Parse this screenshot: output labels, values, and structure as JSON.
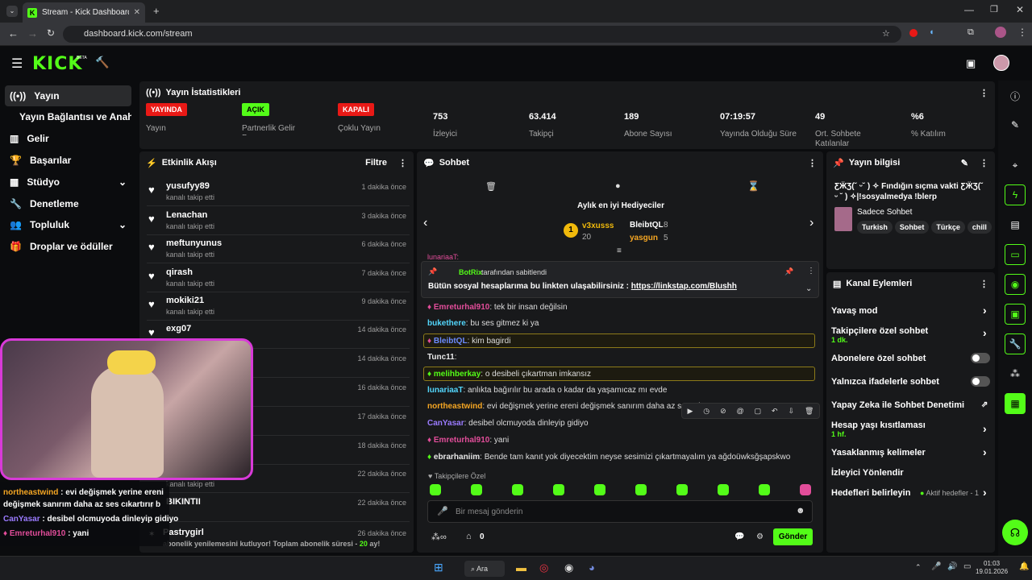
{
  "browser": {
    "tab_title": "Stream - Kick Dashboard",
    "url": "dashboard.kick.com/stream"
  },
  "nav": {
    "logo": "KICK",
    "beta": "BETA"
  },
  "sidebar": {
    "items": [
      {
        "label": "Yayın",
        "icon": "broadcast-icon"
      },
      {
        "label": "Yayın Bağlantısı ve Anahtarı"
      },
      {
        "label": "Gelir",
        "icon": "chart-icon"
      },
      {
        "label": "Başarılar",
        "icon": "trophy-icon"
      },
      {
        "label": "Stüdyo",
        "icon": "studio-icon"
      },
      {
        "label": "Denetleme",
        "icon": "wrench-icon"
      },
      {
        "label": "Topluluk",
        "icon": "community-icon"
      },
      {
        "label": "Droplar ve ödüller",
        "icon": "gift-icon"
      }
    ]
  },
  "stats": {
    "title": "Yayın İstatistikleri",
    "items": [
      {
        "badge": "YAYINDA",
        "label": "Yayın",
        "color": "#e91916"
      },
      {
        "badge": "AÇIK",
        "label": "Partnerlik Gelir Programı",
        "color": "#53fc18"
      },
      {
        "badge": "KAPALI",
        "label": "Çoklu Yayın",
        "color": "#e91916"
      },
      {
        "value": "753",
        "label": "İzleyici"
      },
      {
        "value": "63.414",
        "label": "Takipçi"
      },
      {
        "value": "189",
        "label": "Abone Sayısı"
      },
      {
        "value": "07:19:57",
        "label": "Yayında Olduğu Süre"
      },
      {
        "value": "49",
        "label": "Ort. Sohbete Katılanlar"
      },
      {
        "value": "%6",
        "label": "% Katılım"
      }
    ]
  },
  "activity": {
    "title": "Etkinlik Akışı",
    "filter": "Filtre",
    "items": [
      {
        "name": "yusufyy89",
        "sub": "kanalı takip etti",
        "time": "1 dakika önce"
      },
      {
        "name": "Lenachan",
        "sub": "kanalı takip etti",
        "time": "3 dakika önce"
      },
      {
        "name": "meftunyunus",
        "sub": "kanalı takip etti",
        "time": "6 dakika önce"
      },
      {
        "name": "qirash",
        "sub": "kanalı takip etti",
        "time": "7 dakika önce"
      },
      {
        "name": "mokiki21",
        "sub": "kanalı takip etti",
        "time": "9 dakika önce"
      },
      {
        "name": "exg07",
        "sub": "",
        "time": "14 dakika önce"
      },
      {
        "name": "",
        "sub": "",
        "time": "14 dakika önce"
      },
      {
        "name": "",
        "sub": "",
        "time": "16 dakika önce"
      },
      {
        "name": "",
        "sub": "",
        "time": "17 dakika önce"
      },
      {
        "name": "",
        "sub": "",
        "time": "18 dakika önce"
      },
      {
        "name": "",
        "sub": "kanalı takip etti",
        "time": "22 dakika önce"
      },
      {
        "name": "BIKINTII",
        "sub": "",
        "time": "22 dakika önce"
      }
    ],
    "last": {
      "name": "Pastrygirl",
      "text": "abonelik yenilemesini kutluyor! Toplam abonelik süresi - ",
      "months": "20",
      "suffix": " ay!",
      "time": "26 dakika önce"
    }
  },
  "chat": {
    "title": "Sohbet",
    "gifters_title": "Aylık en iyi Hediyeciler",
    "gifters": [
      {
        "name": "v3xusss",
        "count": "20"
      },
      {
        "name": "BleibtQL",
        "count": "8"
      },
      {
        "name": "yasgun",
        "count": "5"
      }
    ],
    "pinned_by": "BotRix",
    "pinned_by_suffix": "tarafından sabitlendi",
    "pinned_text": "Bütün sosyal hesaplarıma bu linkten ulaşabilirsiniz : ",
    "pinned_link": "https://linkstap.com/Blushh",
    "partial_user": "lunariaaT:",
    "messages": [
      {
        "user": "Emreturhal910",
        "text": ": tek bir insan değilsin",
        "color": "#e24d9a"
      },
      {
        "user": "bukethere",
        "text": ": bu ses gitmez ki ya",
        "color": "#53d6fc"
      },
      {
        "user": "BleibtQL",
        "text": ": kim bagirdi",
        "color": "#6c8cff"
      },
      {
        "user": "Tunc11",
        "text": ":",
        "color": "#e8e8e8"
      },
      {
        "user": "melihberkay",
        "text": ": o desibeli çıkartman imkansız",
        "color": "#53fc18"
      },
      {
        "user": "lunariaaT",
        "text": ": anlıkta bağırılır bu arada o kadar da yaşamıcaz mı evde",
        "color": "#53d6fc"
      },
      {
        "user": "northeastwind",
        "text": ": evi değişmek yerine ereni değişmek sanırım daha az ses çık",
        "color": "#f5a623"
      },
      {
        "user": "CanYasar",
        "text": ": desibel olcmuyoda dinleyip gidiyo",
        "color": "#9b7bff"
      },
      {
        "user": "Emreturhal910",
        "text": ": yani",
        "color": "#e24d9a"
      },
      {
        "user": "ebrarhaniim",
        "text": ": Bende tam kanıt yok diyecektim neyse sesimizi çıkartmayalım ya ağdoüwksğşapskwo",
        "color": "#e8e8e8"
      }
    ],
    "mode": "Takipçilere Özel",
    "input_placeholder": "Bir mesaj gönderin",
    "points": "0",
    "send": "Gönder"
  },
  "info": {
    "title": "Yayın bilgisi",
    "stream_title": "ƸӜƷ(˘ ᵕ˘ ) ✧ Fındığın sıçma vakti ƸӜƷ(˘ ᵕ ˘ ) ✧|!sosyalmedya !blerp",
    "category": "Sadece Sohbet",
    "tags": [
      "Turkish",
      "Sohbet",
      "Türkçe",
      "chill"
    ]
  },
  "actions": {
    "title": "Kanal Eylemleri",
    "items": [
      {
        "label": "Yavaş mod",
        "type": "chevron"
      },
      {
        "label": "Takipçilere özel sohbet",
        "sub": "1 dk.",
        "type": "chevron"
      },
      {
        "label": "Abonelere özel sohbet",
        "type": "toggle"
      },
      {
        "label": "Yalnızca ifadelerle sohbet",
        "type": "toggle"
      },
      {
        "label": "Yapay Zeka ile Sohbet Denetimi",
        "type": "external"
      },
      {
        "label": "Hesap yaşı kısıtlaması",
        "sub": "1 hf.",
        "type": "chevron"
      },
      {
        "label": "Yasaklanmış kelimeler",
        "type": "chevron"
      },
      {
        "label": "İzleyici Yönlendir",
        "type": "none"
      },
      {
        "label": "Hedefleri belirleyin",
        "extra": "Aktif hedefler - 1",
        "type": "chevron"
      }
    ]
  },
  "overlay_chat": [
    {
      "user": "northeastwind",
      "text": " : evi değişmek yerine ereni",
      "color": "#f5a623"
    },
    {
      "user": "",
      "text": "değişmek sanırım daha az ses cıkartırır b",
      "color": "#ffffff"
    },
    {
      "user": "CanYasar",
      "text": " : desibel olcmuyoda dinleyip gidiyo",
      "color": "#9b7bff"
    },
    {
      "user": "Emreturhal910",
      "text": " : yani",
      "color": "#e24d9a"
    }
  ],
  "taskbar": {
    "search": "Ara",
    "time": "01:03",
    "date": "19.01.2026"
  },
  "colors": {
    "accent": "#53fc18",
    "bg": "#0b0c0e",
    "panel": "#18191b",
    "live": "#e91916"
  }
}
